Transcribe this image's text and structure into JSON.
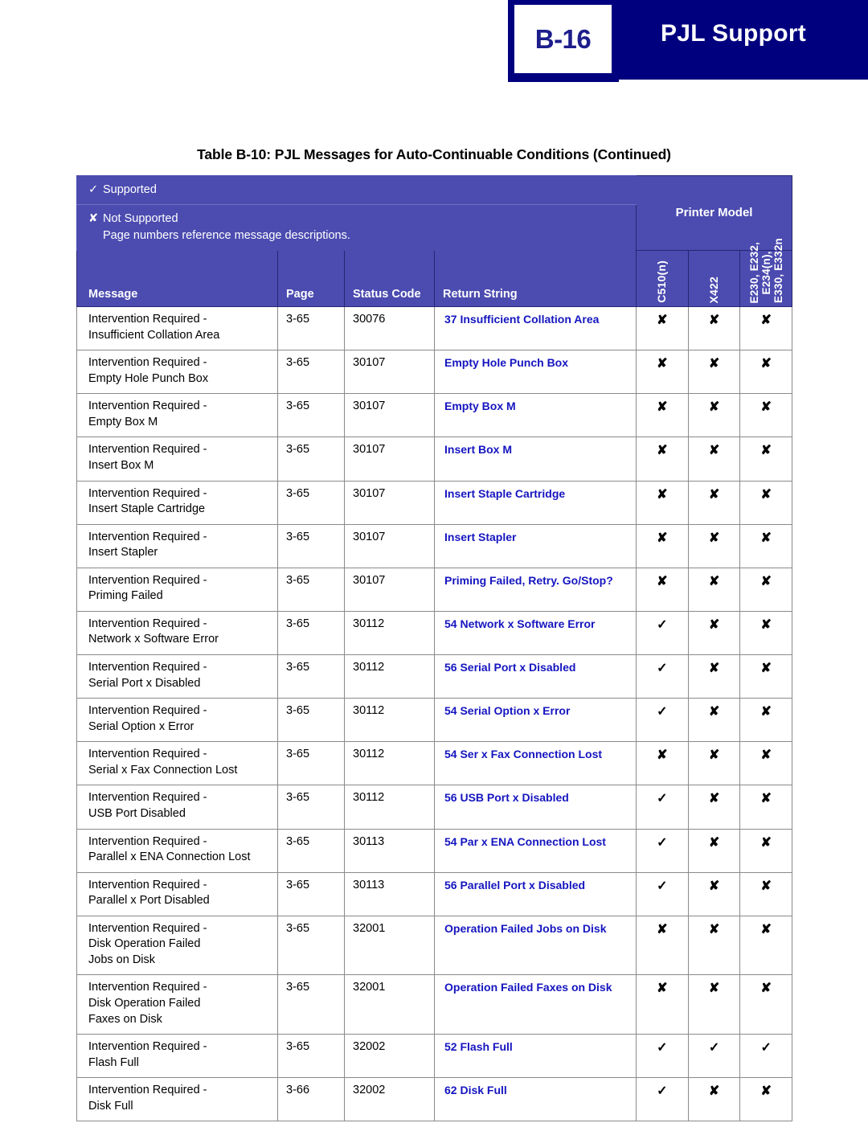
{
  "header": {
    "folio": "B-16",
    "title": "PJL Support"
  },
  "table": {
    "caption": "Table B-10:  PJL Messages for Auto-Continuable Conditions (Continued)",
    "legend": {
      "supported_symbol": "✓",
      "supported_label": "Supported",
      "not_supported_symbol": "✘",
      "not_supported_label": "Not Supported",
      "note": "Page numbers reference message descriptions."
    },
    "group_header": "Printer Model",
    "columns": {
      "message": "Message",
      "page": "Page",
      "status_code": "Status Code",
      "return_string": "Return String"
    },
    "model_columns": [
      {
        "label": "C510(n)",
        "line1": "C510(n)",
        "line2": ""
      },
      {
        "label": "X422",
        "line1": "X422",
        "line2": ""
      },
      {
        "label": "E230, E232, E234(n), E330, E332n",
        "line1": "E230, E232,",
        "line2": "E330, E332n",
        "line1b": "E234(n),",
        "stacked": true
      }
    ],
    "colors": {
      "banner": "#00007f",
      "header_purple": "#4b4bb0",
      "return_string_blue": "#1515c0",
      "folio_text": "#1d1d8c"
    },
    "rows": [
      {
        "message_lines": [
          "Intervention Required -",
          "Insufficient Collation Area"
        ],
        "page": "3-65",
        "status_code": "30076",
        "return_string": "37 Insufficient Collation Area",
        "marks": [
          "✘",
          "✘",
          "✘"
        ]
      },
      {
        "message_lines": [
          "Intervention Required -",
          "Empty Hole Punch Box"
        ],
        "page": "3-65",
        "status_code": "30107",
        "return_string": "Empty Hole Punch Box",
        "marks": [
          "✘",
          "✘",
          "✘"
        ]
      },
      {
        "message_lines": [
          "Intervention Required -",
          "Empty Box M"
        ],
        "page": "3-65",
        "status_code": "30107",
        "return_string": "Empty Box M",
        "marks": [
          "✘",
          "✘",
          "✘"
        ]
      },
      {
        "message_lines": [
          "Intervention Required -",
          "Insert Box M"
        ],
        "page": "3-65",
        "status_code": "30107",
        "return_string": "Insert Box M",
        "marks": [
          "✘",
          "✘",
          "✘"
        ]
      },
      {
        "message_lines": [
          "Intervention Required -",
          "Insert Staple Cartridge"
        ],
        "page": "3-65",
        "status_code": "30107",
        "return_string": "Insert Staple Cartridge",
        "marks": [
          "✘",
          "✘",
          "✘"
        ]
      },
      {
        "message_lines": [
          "Intervention Required -",
          "Insert Stapler"
        ],
        "page": "3-65",
        "status_code": "30107",
        "return_string": "Insert Stapler",
        "marks": [
          "✘",
          "✘",
          "✘"
        ]
      },
      {
        "message_lines": [
          "Intervention Required -",
          "Priming Failed"
        ],
        "page": "3-65",
        "status_code": "30107",
        "return_string": "Priming Failed, Retry. Go/Stop?",
        "marks": [
          "✘",
          "✘",
          "✘"
        ]
      },
      {
        "message_lines": [
          "Intervention Required -",
          "Network x Software Error"
        ],
        "page": "3-65",
        "status_code": "30112",
        "return_string": "54 Network x Software Error",
        "marks": [
          "✓",
          "✘",
          "✘"
        ]
      },
      {
        "message_lines": [
          "Intervention Required -",
          "Serial Port x Disabled"
        ],
        "page": "3-65",
        "status_code": "30112",
        "return_string": "56 Serial Port x Disabled",
        "marks": [
          "✓",
          "✘",
          "✘"
        ]
      },
      {
        "message_lines": [
          "Intervention Required -",
          "Serial Option x Error"
        ],
        "page": "3-65",
        "status_code": "30112",
        "return_string": "54 Serial Option x Error",
        "marks": [
          "✓",
          "✘",
          "✘"
        ]
      },
      {
        "message_lines": [
          "Intervention Required -",
          "Serial x Fax Connection Lost"
        ],
        "page": "3-65",
        "status_code": "30112",
        "return_string": "54 Ser x Fax Connection Lost",
        "marks": [
          "✘",
          "✘",
          "✘"
        ]
      },
      {
        "message_lines": [
          "Intervention Required -",
          "USB Port Disabled"
        ],
        "page": "3-65",
        "status_code": "30112",
        "return_string": "56 USB Port x Disabled",
        "marks": [
          "✓",
          "✘",
          "✘"
        ]
      },
      {
        "message_lines": [
          "Intervention Required -",
          "Parallel x ENA Connection Lost"
        ],
        "page": "3-65",
        "status_code": "30113",
        "return_string": "54 Par x ENA Connection Lost",
        "marks": [
          "✓",
          "✘",
          "✘"
        ]
      },
      {
        "message_lines": [
          "Intervention Required -",
          "Parallel x Port Disabled"
        ],
        "page": "3-65",
        "status_code": "30113",
        "return_string": "56 Parallel Port x Disabled",
        "marks": [
          "✓",
          "✘",
          "✘"
        ]
      },
      {
        "message_lines": [
          "Intervention Required -",
          "Disk Operation Failed",
          "Jobs on Disk"
        ],
        "page": "3-65",
        "status_code": "32001",
        "return_string": "Operation Failed Jobs on Disk",
        "marks": [
          "✘",
          "✘",
          "✘"
        ]
      },
      {
        "message_lines": [
          "Intervention Required -",
          "Disk Operation Failed",
          "Faxes on Disk"
        ],
        "page": "3-65",
        "status_code": "32001",
        "return_string": "Operation Failed Faxes on Disk",
        "marks": [
          "✘",
          "✘",
          "✘"
        ]
      },
      {
        "message_lines": [
          "Intervention Required -",
          "Flash Full"
        ],
        "page": "3-65",
        "status_code": "32002",
        "return_string": "52 Flash Full",
        "marks": [
          "✓",
          "✓",
          "✓"
        ]
      },
      {
        "message_lines": [
          "Intervention Required -",
          "Disk Full"
        ],
        "page": "3-66",
        "status_code": "32002",
        "return_string": "62 Disk Full",
        "marks": [
          "✓",
          "✘",
          "✘"
        ]
      }
    ]
  }
}
